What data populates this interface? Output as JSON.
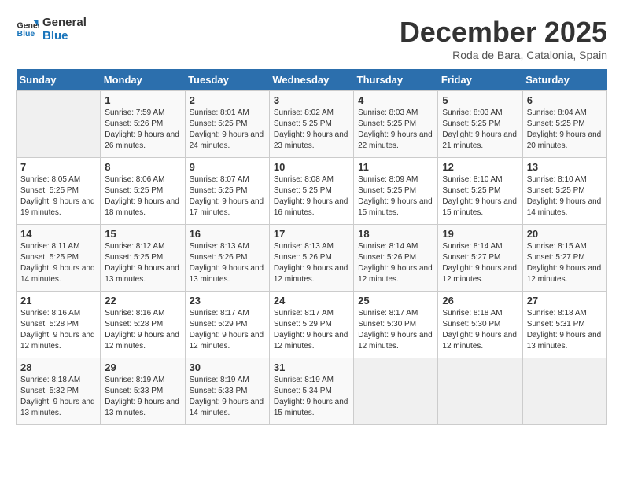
{
  "header": {
    "logo_line1": "General",
    "logo_line2": "Blue",
    "month_title": "December 2025",
    "location": "Roda de Bara, Catalonia, Spain"
  },
  "days_of_week": [
    "Sunday",
    "Monday",
    "Tuesday",
    "Wednesday",
    "Thursday",
    "Friday",
    "Saturday"
  ],
  "weeks": [
    [
      {
        "day": "",
        "sunrise": "",
        "sunset": "",
        "daylight": ""
      },
      {
        "day": "1",
        "sunrise": "Sunrise: 7:59 AM",
        "sunset": "Sunset: 5:26 PM",
        "daylight": "Daylight: 9 hours and 26 minutes."
      },
      {
        "day": "2",
        "sunrise": "Sunrise: 8:01 AM",
        "sunset": "Sunset: 5:25 PM",
        "daylight": "Daylight: 9 hours and 24 minutes."
      },
      {
        "day": "3",
        "sunrise": "Sunrise: 8:02 AM",
        "sunset": "Sunset: 5:25 PM",
        "daylight": "Daylight: 9 hours and 23 minutes."
      },
      {
        "day": "4",
        "sunrise": "Sunrise: 8:03 AM",
        "sunset": "Sunset: 5:25 PM",
        "daylight": "Daylight: 9 hours and 22 minutes."
      },
      {
        "day": "5",
        "sunrise": "Sunrise: 8:03 AM",
        "sunset": "Sunset: 5:25 PM",
        "daylight": "Daylight: 9 hours and 21 minutes."
      },
      {
        "day": "6",
        "sunrise": "Sunrise: 8:04 AM",
        "sunset": "Sunset: 5:25 PM",
        "daylight": "Daylight: 9 hours and 20 minutes."
      }
    ],
    [
      {
        "day": "7",
        "sunrise": "Sunrise: 8:05 AM",
        "sunset": "Sunset: 5:25 PM",
        "daylight": "Daylight: 9 hours and 19 minutes."
      },
      {
        "day": "8",
        "sunrise": "Sunrise: 8:06 AM",
        "sunset": "Sunset: 5:25 PM",
        "daylight": "Daylight: 9 hours and 18 minutes."
      },
      {
        "day": "9",
        "sunrise": "Sunrise: 8:07 AM",
        "sunset": "Sunset: 5:25 PM",
        "daylight": "Daylight: 9 hours and 17 minutes."
      },
      {
        "day": "10",
        "sunrise": "Sunrise: 8:08 AM",
        "sunset": "Sunset: 5:25 PM",
        "daylight": "Daylight: 9 hours and 16 minutes."
      },
      {
        "day": "11",
        "sunrise": "Sunrise: 8:09 AM",
        "sunset": "Sunset: 5:25 PM",
        "daylight": "Daylight: 9 hours and 15 minutes."
      },
      {
        "day": "12",
        "sunrise": "Sunrise: 8:10 AM",
        "sunset": "Sunset: 5:25 PM",
        "daylight": "Daylight: 9 hours and 15 minutes."
      },
      {
        "day": "13",
        "sunrise": "Sunrise: 8:10 AM",
        "sunset": "Sunset: 5:25 PM",
        "daylight": "Daylight: 9 hours and 14 minutes."
      }
    ],
    [
      {
        "day": "14",
        "sunrise": "Sunrise: 8:11 AM",
        "sunset": "Sunset: 5:25 PM",
        "daylight": "Daylight: 9 hours and 14 minutes."
      },
      {
        "day": "15",
        "sunrise": "Sunrise: 8:12 AM",
        "sunset": "Sunset: 5:25 PM",
        "daylight": "Daylight: 9 hours and 13 minutes."
      },
      {
        "day": "16",
        "sunrise": "Sunrise: 8:13 AM",
        "sunset": "Sunset: 5:26 PM",
        "daylight": "Daylight: 9 hours and 13 minutes."
      },
      {
        "day": "17",
        "sunrise": "Sunrise: 8:13 AM",
        "sunset": "Sunset: 5:26 PM",
        "daylight": "Daylight: 9 hours and 12 minutes."
      },
      {
        "day": "18",
        "sunrise": "Sunrise: 8:14 AM",
        "sunset": "Sunset: 5:26 PM",
        "daylight": "Daylight: 9 hours and 12 minutes."
      },
      {
        "day": "19",
        "sunrise": "Sunrise: 8:14 AM",
        "sunset": "Sunset: 5:27 PM",
        "daylight": "Daylight: 9 hours and 12 minutes."
      },
      {
        "day": "20",
        "sunrise": "Sunrise: 8:15 AM",
        "sunset": "Sunset: 5:27 PM",
        "daylight": "Daylight: 9 hours and 12 minutes."
      }
    ],
    [
      {
        "day": "21",
        "sunrise": "Sunrise: 8:16 AM",
        "sunset": "Sunset: 5:28 PM",
        "daylight": "Daylight: 9 hours and 12 minutes."
      },
      {
        "day": "22",
        "sunrise": "Sunrise: 8:16 AM",
        "sunset": "Sunset: 5:28 PM",
        "daylight": "Daylight: 9 hours and 12 minutes."
      },
      {
        "day": "23",
        "sunrise": "Sunrise: 8:17 AM",
        "sunset": "Sunset: 5:29 PM",
        "daylight": "Daylight: 9 hours and 12 minutes."
      },
      {
        "day": "24",
        "sunrise": "Sunrise: 8:17 AM",
        "sunset": "Sunset: 5:29 PM",
        "daylight": "Daylight: 9 hours and 12 minutes."
      },
      {
        "day": "25",
        "sunrise": "Sunrise: 8:17 AM",
        "sunset": "Sunset: 5:30 PM",
        "daylight": "Daylight: 9 hours and 12 minutes."
      },
      {
        "day": "26",
        "sunrise": "Sunrise: 8:18 AM",
        "sunset": "Sunset: 5:30 PM",
        "daylight": "Daylight: 9 hours and 12 minutes."
      },
      {
        "day": "27",
        "sunrise": "Sunrise: 8:18 AM",
        "sunset": "Sunset: 5:31 PM",
        "daylight": "Daylight: 9 hours and 13 minutes."
      }
    ],
    [
      {
        "day": "28",
        "sunrise": "Sunrise: 8:18 AM",
        "sunset": "Sunset: 5:32 PM",
        "daylight": "Daylight: 9 hours and 13 minutes."
      },
      {
        "day": "29",
        "sunrise": "Sunrise: 8:19 AM",
        "sunset": "Sunset: 5:33 PM",
        "daylight": "Daylight: 9 hours and 13 minutes."
      },
      {
        "day": "30",
        "sunrise": "Sunrise: 8:19 AM",
        "sunset": "Sunset: 5:33 PM",
        "daylight": "Daylight: 9 hours and 14 minutes."
      },
      {
        "day": "31",
        "sunrise": "Sunrise: 8:19 AM",
        "sunset": "Sunset: 5:34 PM",
        "daylight": "Daylight: 9 hours and 15 minutes."
      },
      {
        "day": "",
        "sunrise": "",
        "sunset": "",
        "daylight": ""
      },
      {
        "day": "",
        "sunrise": "",
        "sunset": "",
        "daylight": ""
      },
      {
        "day": "",
        "sunrise": "",
        "sunset": "",
        "daylight": ""
      }
    ]
  ]
}
